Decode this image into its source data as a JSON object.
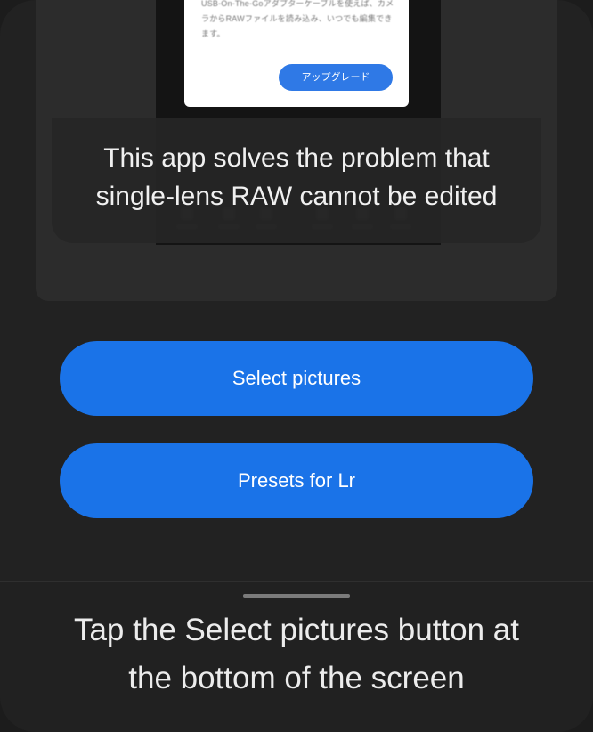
{
  "preview": {
    "dialog_text": "USB-On-The-Goアダプターケーブルを使えば、カメラからRAWファイルを読み込み、いつでも編集できます。",
    "dialog_button": "アップグレード",
    "caption_line1": "This app solves the problem that",
    "caption_line2": "single-lens RAW cannot be edited"
  },
  "actions": {
    "select_pictures": "Select pictures",
    "presets_for_lr": "Presets for Lr"
  },
  "instruction": {
    "line1": "Tap the Select pictures button at",
    "line2": "the bottom of the screen"
  },
  "colors": {
    "background": "#222222",
    "button": "#1a73e8",
    "panel": "#2c2c2c"
  }
}
